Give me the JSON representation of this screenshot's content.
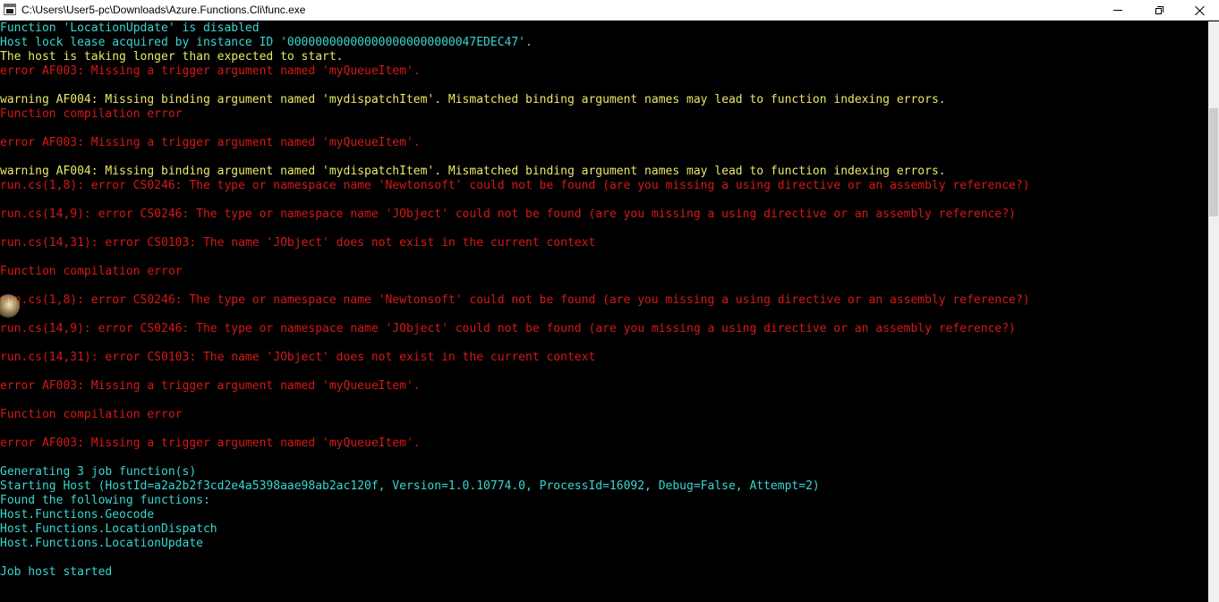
{
  "window": {
    "title": "C:\\Users\\User5-pc\\Downloads\\Azure.Functions.Cli\\func.exe",
    "app_icon": "console-window-icon",
    "controls": [
      "minimize-icon",
      "maximize-icon",
      "close-icon"
    ]
  },
  "colors": {
    "background": "#000000",
    "info": "#3ad6d2",
    "error": "#d71818",
    "warning": "#e8e869"
  },
  "console": {
    "lines": [
      {
        "text": "Function 'LocationUpdate' is disabled",
        "level": "info"
      },
      {
        "text": "Host lock lease acquired by instance ID '000000000000000000000000047EDEC47'.",
        "level": "info"
      },
      {
        "text": "The host is taking longer than expected to start.",
        "level": "warning"
      },
      {
        "text": "error AF003: Missing a trigger argument named 'myQueueItem'.",
        "level": "error"
      },
      {
        "text": "",
        "level": "info"
      },
      {
        "text": "warning AF004: Missing binding argument named 'mydispatchItem'. Mismatched binding argument names may lead to function indexing errors.",
        "level": "warning"
      },
      {
        "text": "Function compilation error",
        "level": "error"
      },
      {
        "text": "",
        "level": "info"
      },
      {
        "text": "error AF003: Missing a trigger argument named 'myQueueItem'.",
        "level": "error"
      },
      {
        "text": "",
        "level": "info"
      },
      {
        "text": "warning AF004: Missing binding argument named 'mydispatchItem'. Mismatched binding argument names may lead to function indexing errors.",
        "level": "warning"
      },
      {
        "text": "run.cs(1,8): error CS0246: The type or namespace name 'Newtonsoft' could not be found (are you missing a using directive or an assembly reference?)",
        "level": "error"
      },
      {
        "text": "",
        "level": "info"
      },
      {
        "text": "run.cs(14,9): error CS0246: The type or namespace name 'JObject' could not be found (are you missing a using directive or an assembly reference?)",
        "level": "error"
      },
      {
        "text": "",
        "level": "info"
      },
      {
        "text": "run.cs(14,31): error CS0103: The name 'JObject' does not exist in the current context",
        "level": "error"
      },
      {
        "text": "",
        "level": "info"
      },
      {
        "text": "Function compilation error",
        "level": "error"
      },
      {
        "text": "",
        "level": "info"
      },
      {
        "text": "run.cs(1,8): error CS0246: The type or namespace name 'Newtonsoft' could not be found (are you missing a using directive or an assembly reference?)",
        "level": "error"
      },
      {
        "text": "",
        "level": "info"
      },
      {
        "text": "run.cs(14,9): error CS0246: The type or namespace name 'JObject' could not be found (are you missing a using directive or an assembly reference?)",
        "level": "error"
      },
      {
        "text": "",
        "level": "info"
      },
      {
        "text": "run.cs(14,31): error CS0103: The name 'JObject' does not exist in the current context",
        "level": "error"
      },
      {
        "text": "",
        "level": "info"
      },
      {
        "text": "error AF003: Missing a trigger argument named 'myQueueItem'.",
        "level": "error"
      },
      {
        "text": "",
        "level": "info"
      },
      {
        "text": "Function compilation error",
        "level": "error"
      },
      {
        "text": "",
        "level": "info"
      },
      {
        "text": "error AF003: Missing a trigger argument named 'myQueueItem'.",
        "level": "error"
      },
      {
        "text": "",
        "level": "info"
      },
      {
        "text": "Generating 3 job function(s)",
        "level": "info"
      },
      {
        "text": "Starting Host (HostId=a2a2b2f3cd2e4a5398aae98ab2ac120f, Version=1.0.10774.0, ProcessId=16092, Debug=False, Attempt=2)",
        "level": "info"
      },
      {
        "text": "Found the following functions:",
        "level": "info"
      },
      {
        "text": "Host.Functions.Geocode",
        "level": "info"
      },
      {
        "text": "Host.Functions.LocationDispatch",
        "level": "info"
      },
      {
        "text": "Host.Functions.LocationUpdate",
        "level": "info"
      },
      {
        "text": "",
        "level": "info"
      },
      {
        "text": "Job host started",
        "level": "info"
      }
    ]
  }
}
